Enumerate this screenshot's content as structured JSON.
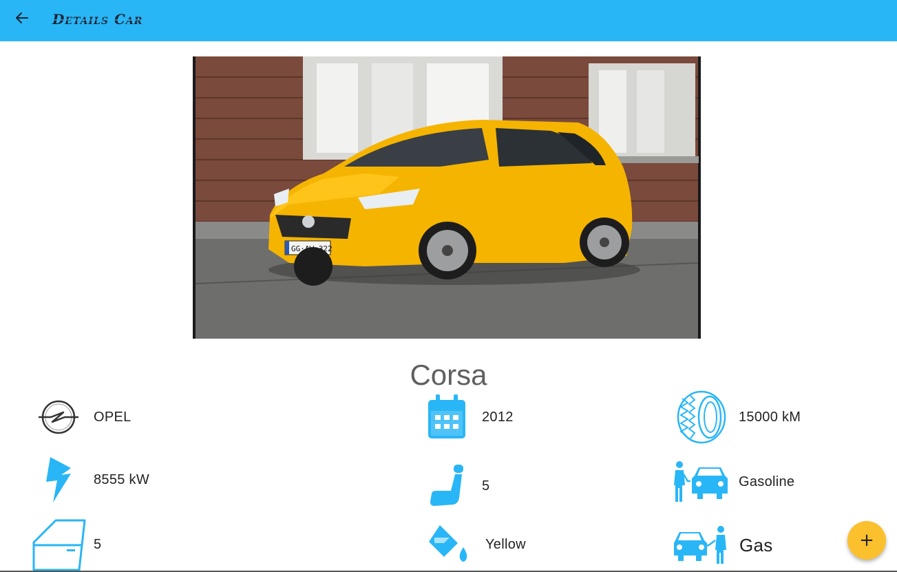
{
  "appbar": {
    "title": "Details Car",
    "background": "#29b6f6",
    "back_icon": "arrow-left-icon"
  },
  "car": {
    "name": "Corsa",
    "photo_plate": "GG·AW 322"
  },
  "attributes": [
    {
      "icon": "opel-logo-icon",
      "value": "OPEL"
    },
    {
      "icon": "calendar-icon",
      "value": "2012"
    },
    {
      "icon": "tire-icon",
      "value": "15000 kM"
    },
    {
      "icon": "lightning-icon",
      "value": "8555 kW"
    },
    {
      "icon": "car-seat-icon",
      "value": "5"
    },
    {
      "icon": "fuel-station-car-icon",
      "value": "Gasoline"
    },
    {
      "icon": "car-door-icon",
      "value": "5"
    },
    {
      "icon": "paint-bucket-icon",
      "value": "Yellow"
    },
    {
      "icon": "car-refuel-icon",
      "value": "Gas"
    }
  ],
  "fab": {
    "label": "+",
    "color": "#fbc02d"
  },
  "accent_color": "#29b6f6"
}
